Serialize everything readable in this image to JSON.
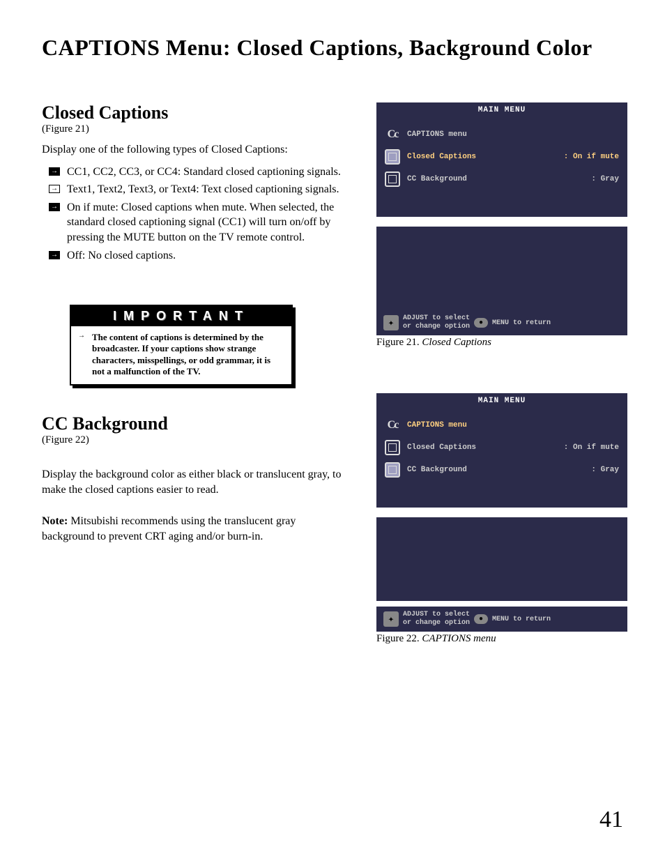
{
  "page_title": "CAPTIONS Menu: Closed Captions, Background Color",
  "page_number": "41",
  "section1": {
    "heading": "Closed Captions",
    "figref": "(Figure 21)",
    "intro": "Display one of the following types of Closed Captions:",
    "bullets": [
      "CC1, CC2, CC3, or CC4: Standard closed captioning signals.",
      "Text1, Text2, Text3, or Text4: Text closed captioning signals.",
      "On if mute: Closed captions when mute.  When selected, the standard closed captioning signal (CC1) will turn on/off by pressing the MUTE button on the TV remote control.",
      "Off: No closed captions."
    ]
  },
  "important": {
    "label": "IMPORTANT",
    "text": "The content of captions is determined by the broadcaster.  If your captions show strange characters, misspellings, or odd grammar, it is not a malfunction of the TV."
  },
  "section2": {
    "heading": "CC Background",
    "figref": "(Figure 22)",
    "body1": "Display the background color as either black or translucent gray, to make the closed captions easier to read.",
    "note_label": "Note:",
    "note_body": "  Mitsubishi recommends using the translucent gray background to prevent CRT aging and/or burn-in."
  },
  "tv": {
    "main_menu": "MAIN MENU",
    "captions_menu": "CAPTIONS menu",
    "row_cc_label": "Closed Captions",
    "row_cc_value": ": On if mute",
    "row_bg_label": "CC Background",
    "row_bg_value": ": Gray",
    "footer_l1": "ADJUST to select",
    "footer_l2": "or change option",
    "footer_r": "MENU to return"
  },
  "fig21_caption_num": "Figure 21.",
  "fig21_caption_txt": "  Closed Captions",
  "fig22_caption_num": "Figure 22.",
  "fig22_caption_txt": "  CAPTIONS menu"
}
